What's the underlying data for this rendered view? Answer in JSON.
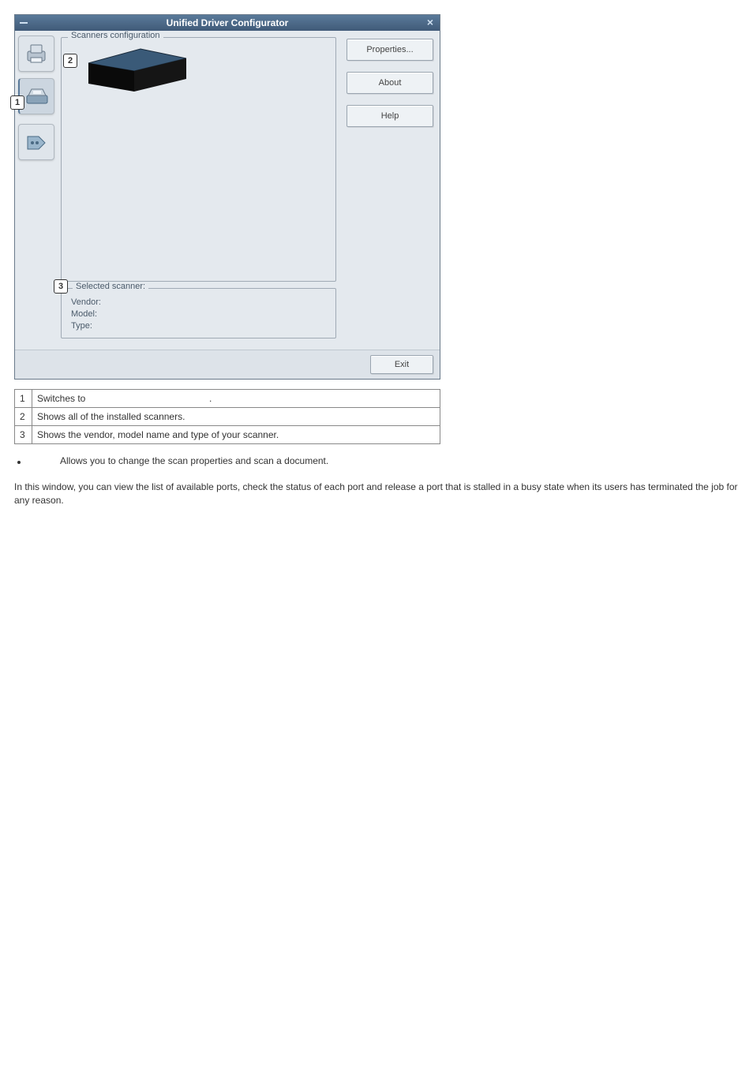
{
  "window": {
    "title": "Unified Driver Configurator",
    "buttons": {
      "properties": "Properties...",
      "about": "About",
      "help": "Help",
      "exit": "Exit"
    },
    "scanners_group_label": "Scanners configuration",
    "selected_group_label": "Selected scanner:",
    "selected_fields": {
      "vendor": "Vendor:",
      "model": "Model:",
      "type": "Type:"
    }
  },
  "legend": {
    "rows": [
      {
        "n": "1",
        "text_a": "Switches to ",
        "text_b": "."
      },
      {
        "n": "2",
        "text_a": "Shows all of the installed scanners.",
        "text_b": ""
      },
      {
        "n": "3",
        "text_a": "Shows the vendor, model name and type of your scanner.",
        "text_b": ""
      }
    ]
  },
  "bullet_text": "Allows you to change the scan properties and scan a document.",
  "body_paragraph": "In this window, you can view the list of available ports, check the status of each port and release a port that is stalled in a busy state when its users has terminated the job for any reason."
}
